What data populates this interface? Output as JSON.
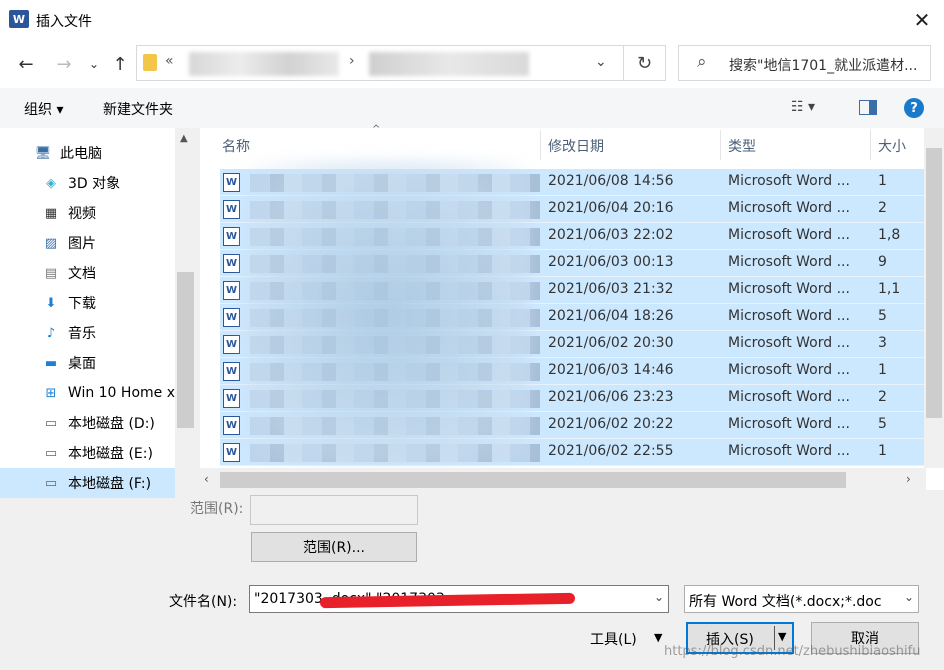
{
  "window": {
    "title": "插入文件",
    "app_icon": "W"
  },
  "nav": {
    "breadcrumb_prefix": "«",
    "search_placeholder": "搜索\"地信1701_就业派遣材..."
  },
  "toolbar": {
    "organize": "组织 ▾",
    "new_folder": "新建文件夹"
  },
  "sidebar": {
    "items": [
      {
        "label": "此电脑",
        "icon": "pc-icon"
      },
      {
        "label": "3D 对象",
        "icon": "cube-icon"
      },
      {
        "label": "视频",
        "icon": "video-icon"
      },
      {
        "label": "图片",
        "icon": "picture-icon"
      },
      {
        "label": "文档",
        "icon": "document-icon"
      },
      {
        "label": "下载",
        "icon": "download-icon"
      },
      {
        "label": "音乐",
        "icon": "music-icon"
      },
      {
        "label": "桌面",
        "icon": "desktop-icon"
      },
      {
        "label": "Win 10 Home x",
        "icon": "windows-drive-icon"
      },
      {
        "label": "本地磁盘 (D:)",
        "icon": "drive-icon"
      },
      {
        "label": "本地磁盘 (E:)",
        "icon": "drive-icon"
      },
      {
        "label": "本地磁盘 (F:)",
        "icon": "drive-icon"
      }
    ]
  },
  "columns": {
    "name": "名称",
    "modified": "修改日期",
    "type": "类型",
    "size": "大小"
  },
  "files": [
    {
      "date": "2021/06/08 14:56",
      "type": "Microsoft Word ...",
      "size": "1"
    },
    {
      "date": "2021/06/04 20:16",
      "type": "Microsoft Word ...",
      "size": "2"
    },
    {
      "date": "2021/06/03 22:02",
      "type": "Microsoft Word ...",
      "size": "1,8"
    },
    {
      "date": "2021/06/03 00:13",
      "type": "Microsoft Word ...",
      "size": "9"
    },
    {
      "date": "2021/06/03 21:32",
      "type": "Microsoft Word ...",
      "size": "1,1"
    },
    {
      "date": "2021/06/04 18:26",
      "type": "Microsoft Word ...",
      "size": "5"
    },
    {
      "date": "2021/06/02 20:30",
      "type": "Microsoft Word ...",
      "size": "3"
    },
    {
      "date": "2021/06/03 14:46",
      "type": "Microsoft Word ...",
      "size": "1"
    },
    {
      "date": "2021/06/06 23:23",
      "type": "Microsoft Word ...",
      "size": "2"
    },
    {
      "date": "2021/06/02 20:22",
      "type": "Microsoft Word ...",
      "size": "5"
    },
    {
      "date": "2021/06/02 22:55",
      "type": "Microsoft Word ...",
      "size": "1"
    }
  ],
  "bottom": {
    "range_label": "范围(R):",
    "range_button": "范围(R)...",
    "filename_label": "文件名(N):",
    "filename_value": "\"2017303                                   .docx\" \"2017303",
    "filter_value": "所有 Word 文档(*.docx;*.doc",
    "tools": "工具(L)",
    "insert": "插入(S)",
    "cancel": "取消"
  },
  "watermark": "https://blog.csdn.net/zhebushibiaoshifu"
}
